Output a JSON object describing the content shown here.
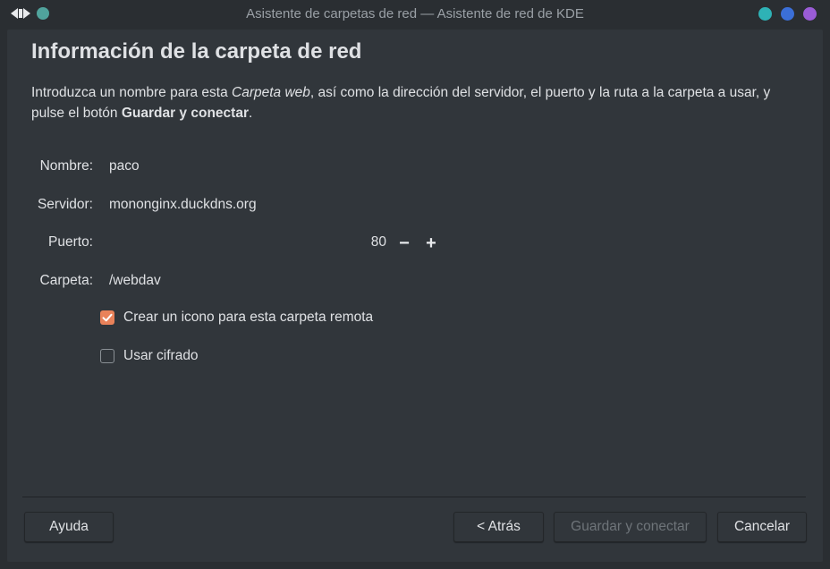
{
  "window": {
    "title": "Asistente de carpetas de red — Asistente de red de KDE"
  },
  "heading": "Información de la carpeta de red",
  "intro": {
    "part1": "Introduzca un nombre para esta ",
    "em": "Carpeta web",
    "part2": ", así como la dirección del servidor, el puerto y la ruta a la carpeta a usar, y pulse el botón ",
    "strong": "Guardar y conectar",
    "part3": "."
  },
  "form": {
    "name_label": "Nombre:",
    "name_value": "paco",
    "server_label": "Servidor:",
    "server_value": "mononginx.duckdns.org",
    "port_label": "Puerto:",
    "port_value": "80",
    "port_decrement": "−",
    "port_increment": "+",
    "folder_label": "Carpeta:",
    "folder_value": "/webdav"
  },
  "options": {
    "create_icon_label": "Crear un icono para esta carpeta remota",
    "create_icon_checked": true,
    "encryption_label": "Usar cifrado",
    "encryption_checked": false
  },
  "buttons": {
    "help": "Ayuda",
    "back": "< Atrás",
    "save_connect": "Guardar y conectar",
    "cancel": "Cancelar"
  },
  "colors": {
    "accent": "#e9825a",
    "titlebar_dot_left": "#50a39c",
    "titlebar_dot_1": "#2eb2b6",
    "titlebar_dot_2": "#3b6fd8",
    "titlebar_dot_3": "#9a5cd6"
  },
  "icons": {
    "titlebar_left": "left-right-arrows-icon",
    "titlebar_dot": "app-menu-dot-icon",
    "checkbox_checked": "checkmark-icon"
  }
}
